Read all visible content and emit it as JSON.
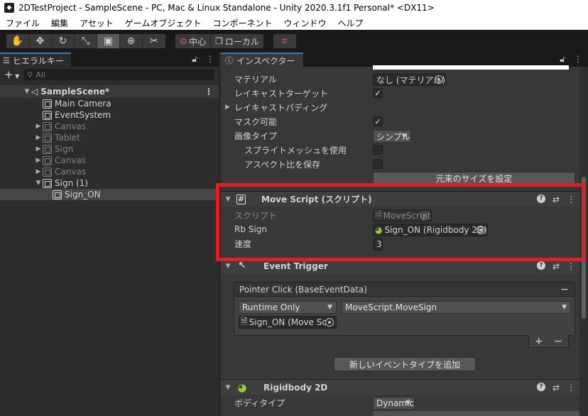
{
  "window": {
    "title": "2DTestProject - SampleScene - PC, Mac & Linux Standalone - Unity 2020.3.1f1 Personal* <DX11>"
  },
  "menu": [
    "ファイル",
    "編集",
    "アセット",
    "ゲームオブジェクト",
    "コンポーネント",
    "ウィンドウ",
    "ヘルプ"
  ],
  "toolbar": {
    "tools": [
      "hand-tool",
      "move-tool",
      "rotate-tool",
      "scale-tool",
      "rect-tool",
      "transform-tool",
      "custom-tool"
    ],
    "active_tool": "rect-tool",
    "pivot_label": "中心",
    "space_label": "ローカル"
  },
  "hierarchy": {
    "tab_label": "ヒエラルキー",
    "add_label": "+",
    "search_placeholder": "All",
    "scene_name": "SampleScene*",
    "items": [
      {
        "label": "Main Camera",
        "dim": false
      },
      {
        "label": "EventSystem",
        "dim": false
      },
      {
        "label": "Canvas",
        "dim": true
      },
      {
        "label": "Tablet",
        "dim": true
      },
      {
        "label": "Sign",
        "dim": true
      },
      {
        "label": "Canvas",
        "dim": true
      },
      {
        "label": "Canvas",
        "dim": true
      },
      {
        "label": "Sign (1)",
        "dim": false
      },
      {
        "label": "Sign_ON",
        "dim": false
      }
    ]
  },
  "inspector": {
    "tab_label": "インスペクター",
    "image": {
      "material_label": "マテリアル",
      "material_value": "なし (マテリアル)",
      "raycast_target_label": "レイキャストターゲット",
      "raycast_padding_label": "レイキャストパディング",
      "maskable_label": "マスク可能",
      "image_type_label": "画像タイプ",
      "image_type_value": "シンプル",
      "use_sprite_mesh_label": "スプライトメッシュを使用",
      "preserve_aspect_label": "アスペクト比を保存",
      "native_size_button": "元来のサイズを設定"
    },
    "move_script": {
      "title": "Move Script (スクリプト)",
      "script_label": "スクリプト",
      "script_value": "MoveScript",
      "rb_sign_label": "Rb Sign",
      "rb_sign_value": "Sign_ON (Rigidbody 2D)",
      "speed_label": "速度",
      "speed_value": "3"
    },
    "event_trigger": {
      "title": "Event Trigger",
      "event_header": "Pointer Click (BaseEventData)",
      "runtime_value": "Runtime Only",
      "function_value": "MoveScript.MoveSign",
      "target_value": "Sign_ON (Move Sc",
      "add_event_button": "新しいイベントタイプを追加",
      "plus_label": "+",
      "minus_label": "−"
    },
    "rigidbody": {
      "title": "Rigidbody 2D",
      "body_type_label": "ボディタイプ",
      "body_type_value": "Dynamic"
    }
  },
  "colors": {
    "highlight": "#e21d24",
    "accent_tab": "#3a79bb"
  }
}
